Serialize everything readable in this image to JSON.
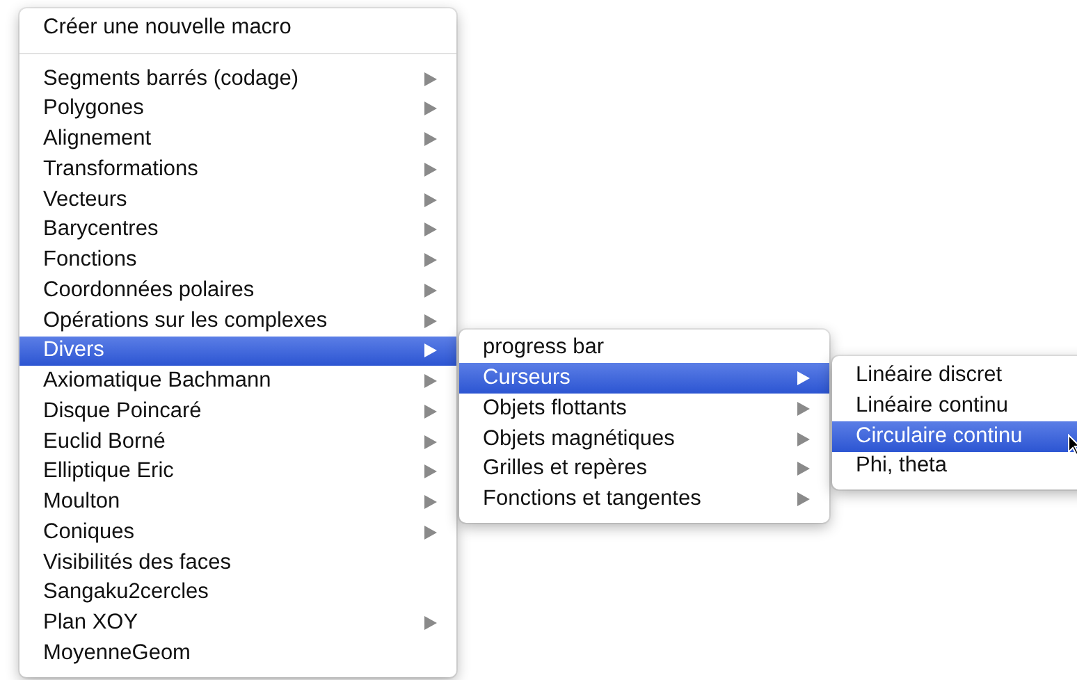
{
  "menus": [
    {
      "items": [
        {
          "kind": "item",
          "label": "Créer une nouvelle macro",
          "submenu": false,
          "selected": false
        },
        {
          "kind": "separator"
        },
        {
          "kind": "item",
          "label": "Segments barrés (codage)",
          "submenu": true,
          "selected": false
        },
        {
          "kind": "item",
          "label": "Polygones",
          "submenu": true,
          "selected": false
        },
        {
          "kind": "item",
          "label": "Alignement",
          "submenu": true,
          "selected": false
        },
        {
          "kind": "item",
          "label": "Transformations",
          "submenu": true,
          "selected": false
        },
        {
          "kind": "item",
          "label": "Vecteurs",
          "submenu": true,
          "selected": false
        },
        {
          "kind": "item",
          "label": "Barycentres",
          "submenu": true,
          "selected": false
        },
        {
          "kind": "item",
          "label": "Fonctions",
          "submenu": true,
          "selected": false
        },
        {
          "kind": "item",
          "label": "Coordonnées polaires",
          "submenu": true,
          "selected": false
        },
        {
          "kind": "item",
          "label": "Opérations sur les complexes",
          "submenu": true,
          "selected": false
        },
        {
          "kind": "item",
          "label": "Divers",
          "submenu": true,
          "selected": true
        },
        {
          "kind": "item",
          "label": "Axiomatique Bachmann",
          "submenu": true,
          "selected": false
        },
        {
          "kind": "item",
          "label": "Disque Poincaré",
          "submenu": true,
          "selected": false
        },
        {
          "kind": "item",
          "label": "Euclid Borné",
          "submenu": true,
          "selected": false
        },
        {
          "kind": "item",
          "label": "Elliptique Eric",
          "submenu": true,
          "selected": false
        },
        {
          "kind": "item",
          "label": "Moulton",
          "submenu": true,
          "selected": false
        },
        {
          "kind": "item",
          "label": "Coniques",
          "submenu": true,
          "selected": false
        },
        {
          "kind": "item",
          "label": "Visibilités des faces",
          "submenu": false,
          "selected": false
        },
        {
          "kind": "item",
          "label": "Sangaku2cercles",
          "submenu": false,
          "selected": false
        },
        {
          "kind": "item",
          "label": "Plan XOY",
          "submenu": true,
          "selected": false
        },
        {
          "kind": "item",
          "label": "MoyenneGeom",
          "submenu": false,
          "selected": false
        }
      ]
    },
    {
      "items": [
        {
          "kind": "item",
          "label": "progress bar",
          "submenu": false,
          "selected": false
        },
        {
          "kind": "item",
          "label": "Curseurs",
          "submenu": true,
          "selected": true
        },
        {
          "kind": "item",
          "label": "Objets flottants",
          "submenu": true,
          "selected": false
        },
        {
          "kind": "item",
          "label": "Objets magnétiques",
          "submenu": true,
          "selected": false
        },
        {
          "kind": "item",
          "label": "Grilles et repères",
          "submenu": true,
          "selected": false
        },
        {
          "kind": "item",
          "label": "Fonctions et tangentes",
          "submenu": true,
          "selected": false
        }
      ]
    },
    {
      "items": [
        {
          "kind": "item",
          "label": "Linéaire discret",
          "submenu": false,
          "selected": false
        },
        {
          "kind": "item",
          "label": "Linéaire continu",
          "submenu": false,
          "selected": false
        },
        {
          "kind": "item",
          "label": "Circulaire continu",
          "submenu": false,
          "selected": true
        },
        {
          "kind": "item",
          "label": "Phi, theta",
          "submenu": false,
          "selected": false
        }
      ]
    }
  ]
}
